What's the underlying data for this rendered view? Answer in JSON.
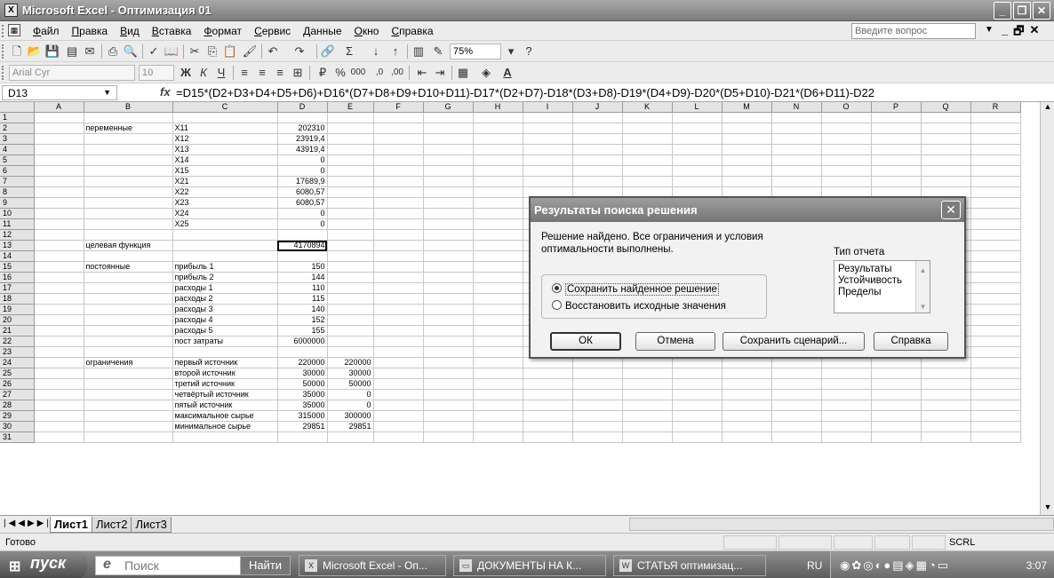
{
  "window": {
    "title": "Microsoft Excel - Оптимизация 01",
    "app_icon": "excel-icon",
    "buttons": [
      "_",
      "❐",
      "✕"
    ]
  },
  "menu": {
    "items": [
      "Файл",
      "Правка",
      "Вид",
      "Вставка",
      "Формат",
      "Сервис",
      "Данные",
      "Окно",
      "Справка"
    ],
    "question_placeholder": "Введите вопрос",
    "doc_buttons": [
      "-",
      "_",
      "🗗",
      "✕"
    ]
  },
  "toolbar": {
    "zoom": "75%",
    "font_name": "Arial Cyr",
    "font_size": "10"
  },
  "formula_bar": {
    "cell_ref": "D13",
    "fx": "fx",
    "formula": "=D15*(D2+D3+D4+D5+D6)+D16*(D7+D8+D9+D10+D11)-D17*(D2+D7)-D18*(D3+D8)-D19*(D4+D9)-D20*(D5+D10)-D21*(D6+D11)-D22"
  },
  "sheet": {
    "columns": [
      "A",
      "B",
      "C",
      "D",
      "E",
      "F",
      "G",
      "H",
      "I",
      "J",
      "K",
      "L",
      "M",
      "N",
      "O",
      "P",
      "Q",
      "R"
    ],
    "selected_cell": "D13",
    "rows": [
      {
        "n": "1",
        "b": "",
        "c": "",
        "d": "",
        "e": ""
      },
      {
        "n": "2",
        "b": "переменные",
        "c": "X11",
        "d": "202310",
        "e": ""
      },
      {
        "n": "3",
        "b": "",
        "c": "X12",
        "d": "23919,4",
        "e": ""
      },
      {
        "n": "4",
        "b": "",
        "c": "X13",
        "d": "43919,4",
        "e": ""
      },
      {
        "n": "5",
        "b": "",
        "c": "X14",
        "d": "0",
        "e": ""
      },
      {
        "n": "6",
        "b": "",
        "c": "X15",
        "d": "0",
        "e": ""
      },
      {
        "n": "7",
        "b": "",
        "c": "X21",
        "d": "17689,9",
        "e": ""
      },
      {
        "n": "8",
        "b": "",
        "c": "X22",
        "d": "6080,57",
        "e": ""
      },
      {
        "n": "9",
        "b": "",
        "c": "X23",
        "d": "6080,57",
        "e": ""
      },
      {
        "n": "10",
        "b": "",
        "c": "X24",
        "d": "0",
        "e": ""
      },
      {
        "n": "11",
        "b": "",
        "c": "X25",
        "d": "0",
        "e": ""
      },
      {
        "n": "12",
        "b": "",
        "c": "",
        "d": "",
        "e": ""
      },
      {
        "n": "13",
        "b": "целевая функция",
        "c": "",
        "d": "4170894",
        "e": ""
      },
      {
        "n": "14",
        "b": "",
        "c": "",
        "d": "",
        "e": ""
      },
      {
        "n": "15",
        "b": "постоянные",
        "c": "прибыль 1",
        "d": "150",
        "e": ""
      },
      {
        "n": "16",
        "b": "",
        "c": "прибыль 2",
        "d": "144",
        "e": ""
      },
      {
        "n": "17",
        "b": "",
        "c": "расходы 1",
        "d": "110",
        "e": ""
      },
      {
        "n": "18",
        "b": "",
        "c": "расходы 2",
        "d": "115",
        "e": ""
      },
      {
        "n": "19",
        "b": "",
        "c": "расходы 3",
        "d": "140",
        "e": ""
      },
      {
        "n": "20",
        "b": "",
        "c": "расходы 4",
        "d": "152",
        "e": ""
      },
      {
        "n": "21",
        "b": "",
        "c": "расходы 5",
        "d": "155",
        "e": ""
      },
      {
        "n": "22",
        "b": "",
        "c": "пост затраты",
        "d": "6000000",
        "e": ""
      },
      {
        "n": "23",
        "b": "",
        "c": "",
        "d": "",
        "e": ""
      },
      {
        "n": "24",
        "b": "ограничения",
        "c": "первый источник",
        "d": "220000",
        "e": "220000"
      },
      {
        "n": "25",
        "b": "",
        "c": "второй источник",
        "d": "30000",
        "e": "30000"
      },
      {
        "n": "26",
        "b": "",
        "c": "третий источник",
        "d": "50000",
        "e": "50000"
      },
      {
        "n": "27",
        "b": "",
        "c": "четвёртый источник",
        "d": "35000",
        "e": "0"
      },
      {
        "n": "28",
        "b": "",
        "c": "пятый источник",
        "d": "35000",
        "e": "0"
      },
      {
        "n": "29",
        "b": "",
        "c": "максимальное сырье",
        "d": "315000",
        "e": "300000"
      },
      {
        "n": "30",
        "b": "",
        "c": "минимальное сырье",
        "d": "29851",
        "e": "29851"
      },
      {
        "n": "31",
        "b": "",
        "c": "",
        "d": "",
        "e": ""
      }
    ],
    "tabs": [
      "Лист1",
      "Лист2",
      "Лист3"
    ],
    "active_tab": "Лист1"
  },
  "status": {
    "text": "Готово",
    "scrl": "SCRL"
  },
  "dialog": {
    "title": "Результаты поиска решения",
    "message": "Решение найдено. Все ограничения и условия оптимальности выполнены.",
    "report_type_label": "Тип отчета",
    "report_types": [
      "Результаты",
      "Устойчивость",
      "Пределы"
    ],
    "radio_keep": "Сохранить найденное решение",
    "radio_restore": "Восстановить исходные значения",
    "btn_ok": "ОК",
    "btn_cancel": "Отмена",
    "btn_save_scenario": "Сохранить сценарий...",
    "btn_help": "Справка"
  },
  "taskbar": {
    "start": "пуск",
    "search_placeholder": "Поиск",
    "find_button": "Найти",
    "items": [
      "Microsoft Excel - Оп...",
      "ДОКУМЕНТЫ НА К...",
      "СТАТЬЯ оптимизац..."
    ],
    "lang": "RU",
    "clock": "3:07"
  }
}
